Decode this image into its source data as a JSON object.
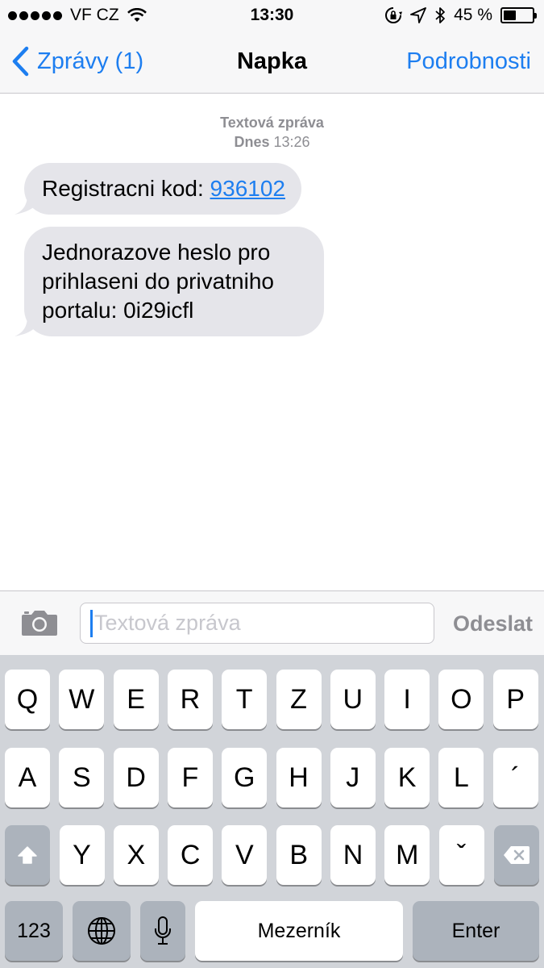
{
  "status_bar": {
    "carrier": "VF CZ",
    "time": "13:30",
    "battery": "45 %",
    "battery_level": 0.45,
    "icons": [
      "signal-dots-icon",
      "wifi-icon",
      "orientation-lock-icon",
      "location-arrow-icon",
      "bluetooth-icon",
      "battery-icon"
    ]
  },
  "nav": {
    "back_label": "Zprávy (1)",
    "title": "Napka",
    "details_label": "Podrobnosti"
  },
  "conversation": {
    "meta_line1": "Textová zpráva",
    "meta_day": "Dnes",
    "meta_time": "13:26",
    "messages": [
      {
        "prefix": "Registracni kod: ",
        "link": "936102"
      },
      {
        "line1": "Jednorazove heslo pro",
        "line2": "prihlaseni do privatniho",
        "line3": "portalu: 0i29icfl"
      }
    ]
  },
  "composer": {
    "placeholder": "Textová zpráva",
    "send_label": "Odeslat"
  },
  "keyboard": {
    "row1": [
      "Q",
      "W",
      "E",
      "R",
      "T",
      "Z",
      "U",
      "I",
      "O",
      "P"
    ],
    "row2": [
      "A",
      "S",
      "D",
      "F",
      "G",
      "H",
      "J",
      "K",
      "L",
      "´"
    ],
    "row3": [
      "Y",
      "X",
      "C",
      "V",
      "B",
      "N",
      "M",
      "ˇ"
    ],
    "numbers_label": "123",
    "space_label": "Mezerník",
    "enter_label": "Enter"
  },
  "colors": {
    "accent": "#1d7ef0",
    "bubble": "#e5e5ea",
    "keyboard_bg": "#d1d4d9"
  }
}
